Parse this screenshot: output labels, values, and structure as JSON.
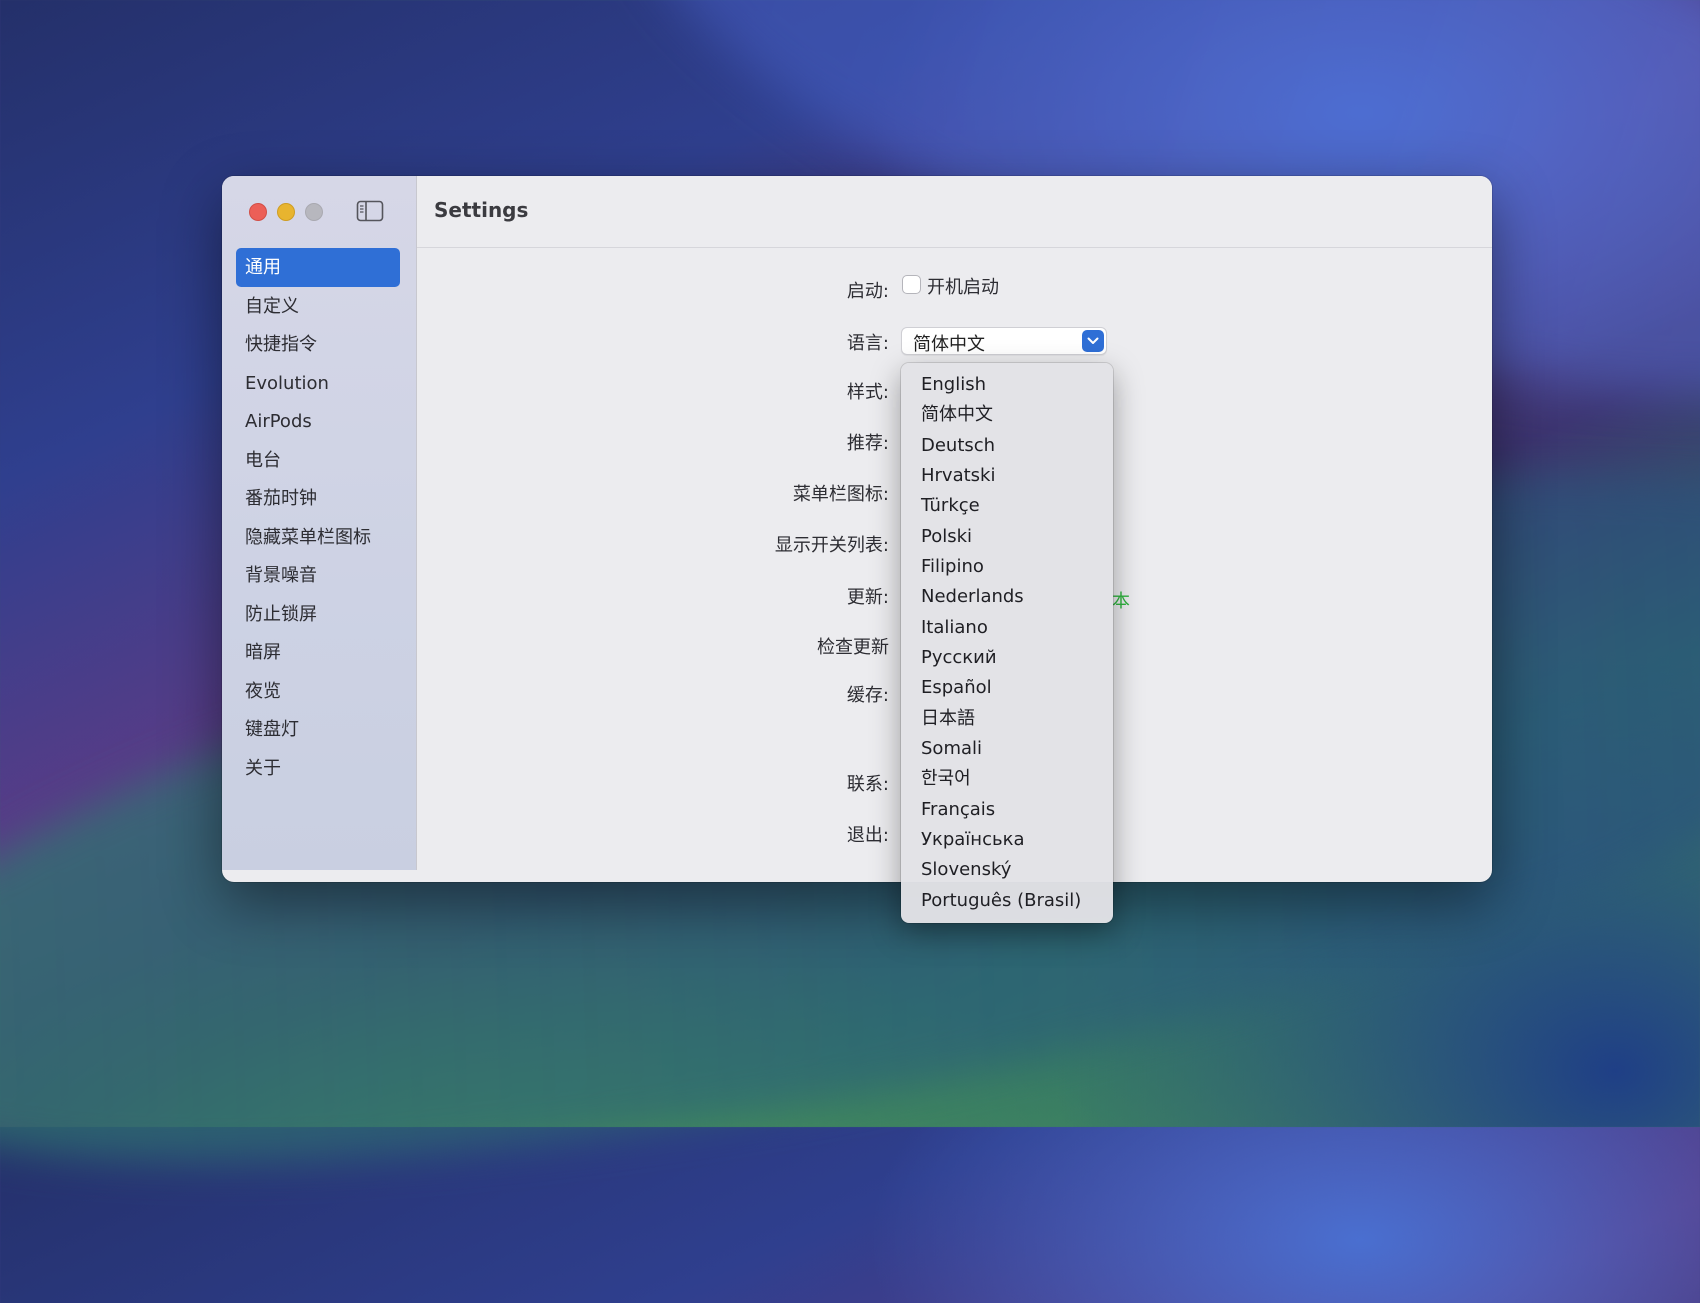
{
  "window": {
    "title": "Settings"
  },
  "sidebar": {
    "items": [
      {
        "label": "通用",
        "active": true
      },
      {
        "label": "自定义"
      },
      {
        "label": "快捷指令"
      },
      {
        "label": "Evolution"
      },
      {
        "label": "AirPods"
      },
      {
        "label": "电台"
      },
      {
        "label": "番茄时钟"
      },
      {
        "label": "隐藏菜单栏图标"
      },
      {
        "label": "背景噪音"
      },
      {
        "label": "防止锁屏"
      },
      {
        "label": "暗屏"
      },
      {
        "label": "夜览"
      },
      {
        "label": "键盘灯"
      },
      {
        "label": "关于"
      }
    ]
  },
  "settings": {
    "labels": {
      "startup": "启动:",
      "language": "语言:",
      "style": "样式:",
      "recommend": "推荐:",
      "menubar_icon": "菜单栏图标:",
      "show_switch_list": "显示开关列表:",
      "update": "更新:",
      "check_update": "检查更新",
      "cache": "缓存:",
      "contact": "联系:",
      "quit": "退出:"
    },
    "startup_checkbox": {
      "label": "开机启动",
      "checked": false
    },
    "language_select": {
      "value": "简体中文"
    },
    "update_partial_text": "本"
  },
  "language_dropdown": {
    "options": [
      "English",
      "简体中文",
      "Deutsch",
      "Hrvatski",
      "Türkçe",
      "Polski",
      "Filipino",
      "Nederlands",
      "Italiano",
      "Русский",
      "Español",
      "日本語",
      "Somali",
      "한국어",
      "Français",
      "Українська",
      "Slovenský",
      "Português (Brasil)"
    ]
  },
  "colors": {
    "accent": "#2f6fd6",
    "green": "#2fb43f"
  },
  "icons": [
    "sidebar-toggle-icon",
    "chevron-down-icon"
  ]
}
